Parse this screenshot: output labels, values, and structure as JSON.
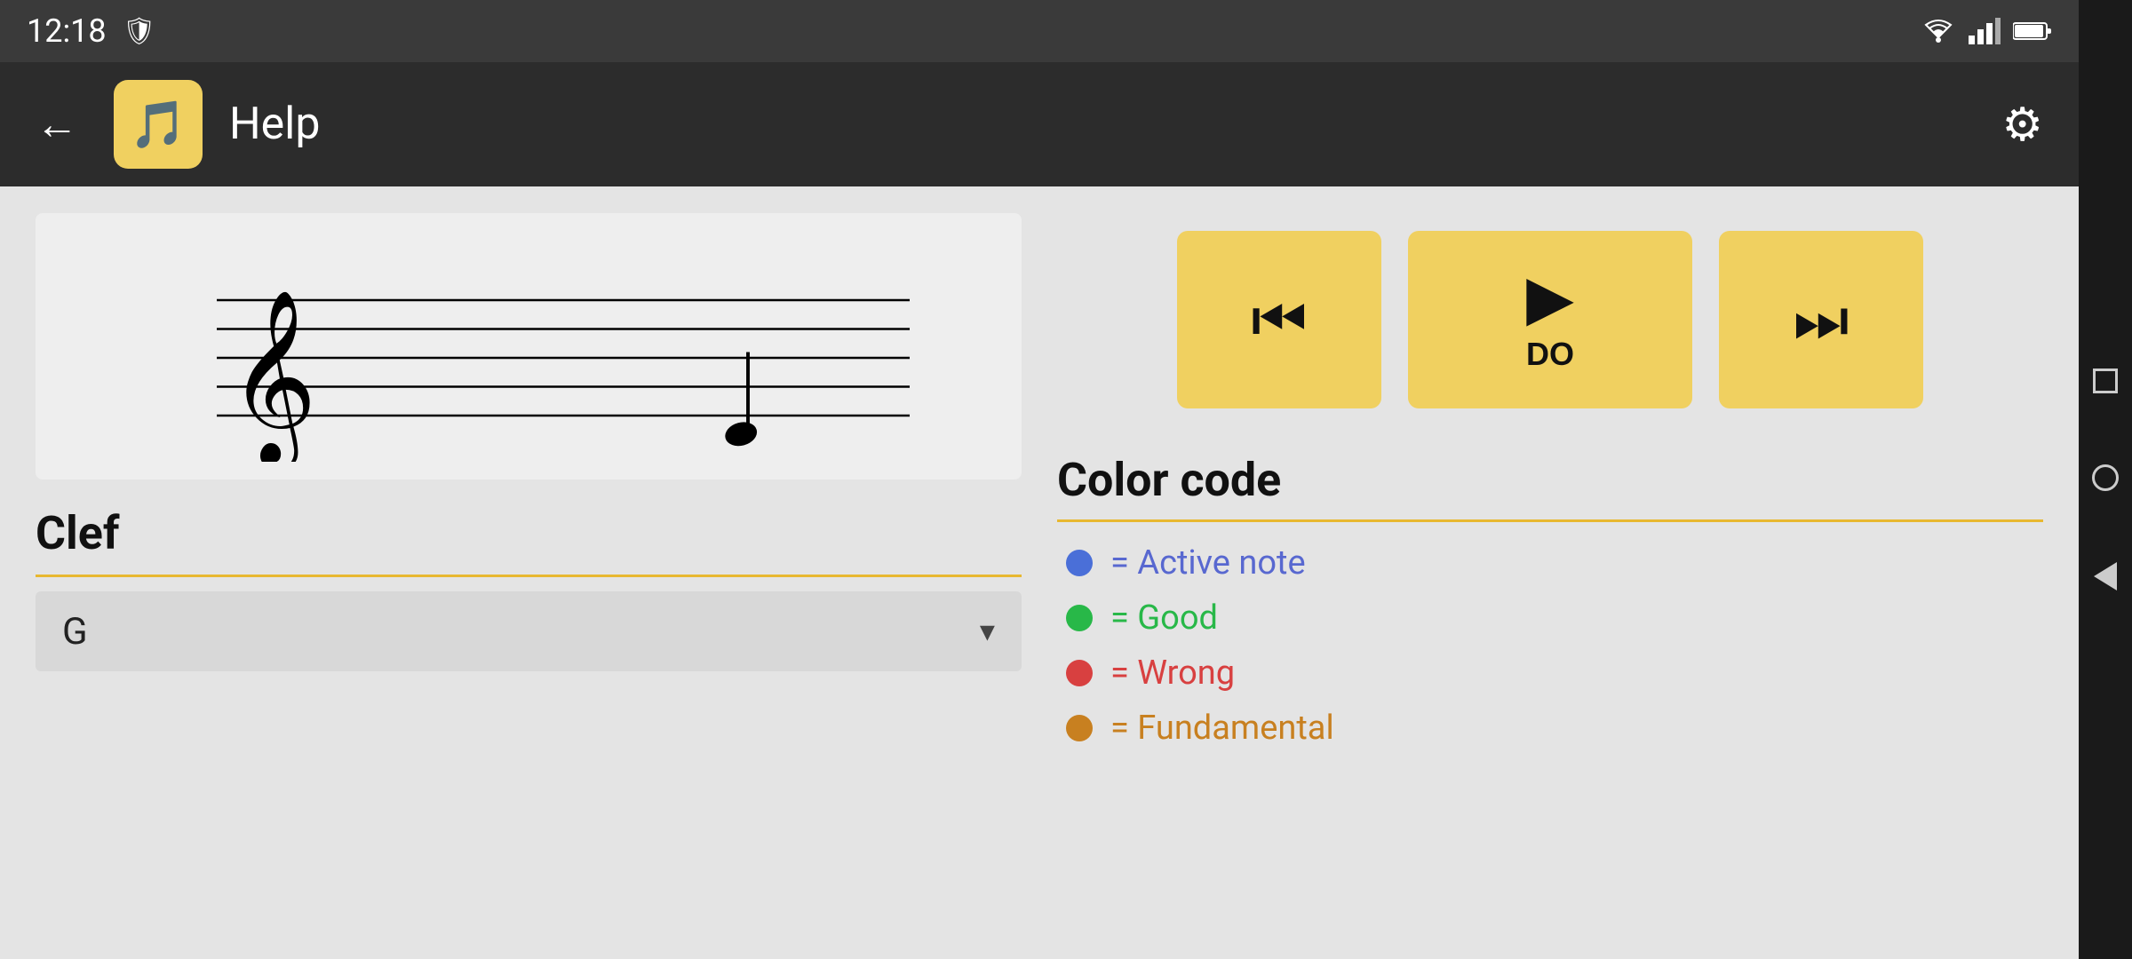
{
  "statusBar": {
    "time": "12:18",
    "shieldIcon": "🛡",
    "wifiIcon": "wifi",
    "signalIcon": "signal",
    "batteryIcon": "battery"
  },
  "appBar": {
    "backLabel": "←",
    "logoIcon": "🎵",
    "title": "Help",
    "settingsIcon": "⚙"
  },
  "transport": {
    "prevIcon": "⏮",
    "playIcon": "▶",
    "playLabel": "DO",
    "nextIcon": "⏭"
  },
  "clef": {
    "title": "Clef",
    "value": "G",
    "dropdownArrow": "▾"
  },
  "colorCode": {
    "title": "Color code",
    "items": [
      {
        "id": "active",
        "dotClass": "color-dot-blue",
        "text": "= Active note",
        "textClass": "color-active"
      },
      {
        "id": "good",
        "dotClass": "color-dot-green",
        "text": "= Good",
        "textClass": "color-good"
      },
      {
        "id": "wrong",
        "dotClass": "color-dot-red",
        "text": "= Wrong",
        "textClass": "color-wrong"
      },
      {
        "id": "fundamental",
        "dotClass": "color-dot-orange",
        "text": "= Fundamental",
        "textClass": "color-fundamental"
      }
    ]
  }
}
